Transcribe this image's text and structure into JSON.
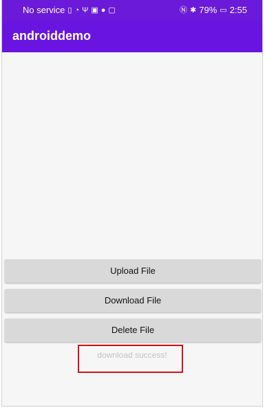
{
  "status_bar": {
    "carrier": "No service",
    "battery": "79%",
    "time": "2:55"
  },
  "app_bar": {
    "title": "androiddemo"
  },
  "buttons": {
    "upload": "Upload File",
    "download": "Download File",
    "delete": "Delete File"
  },
  "status_message": "download success!",
  "colors": {
    "app_bar": "#6a14e2",
    "highlight_border": "#d60f15"
  }
}
